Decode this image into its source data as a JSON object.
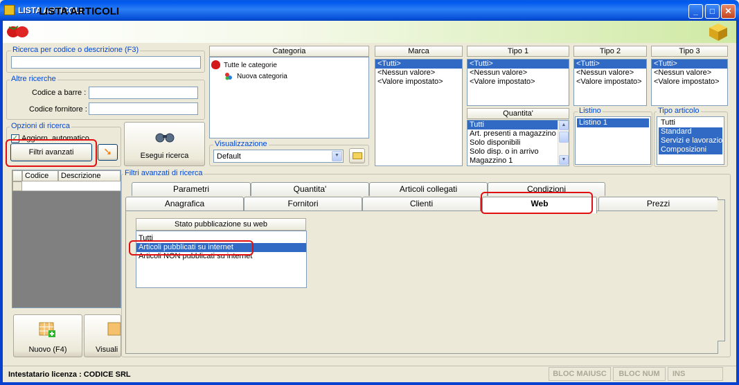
{
  "window": {
    "title": "LISTA ARTICOLI"
  },
  "header": {
    "title": "LISTA ARTICOLI"
  },
  "search": {
    "label": "Ricerca per codice o descrizione (F3)",
    "value": ""
  },
  "altre": {
    "label": "Altre ricerche",
    "barcode_label": "Codice a barre :",
    "supplier_label": "Codice fornitore :"
  },
  "opzioni": {
    "label": "Opzioni di ricerca",
    "auto_update_label": "Aggiorn. automatico",
    "filtri_button": "Filtri avanzati"
  },
  "esegui": {
    "label": "Esegui ricerca"
  },
  "grid": {
    "columns": [
      "Codice",
      "Descrizione"
    ]
  },
  "categoria": {
    "header": "Categoria",
    "root": "Tutte le categorie",
    "child": "Nuova categoria"
  },
  "visualizzazione": {
    "label": "Visualizzazione",
    "value": "Default"
  },
  "marca": {
    "header": "Marca",
    "items": [
      "<Tutti>",
      "<Nessun valore>",
      "<Valore impostato>"
    ]
  },
  "tipo1": {
    "header": "Tipo 1",
    "items": [
      "<Tutti>",
      "<Nessun valore>",
      "<Valore impostato>"
    ]
  },
  "tipo2": {
    "header": "Tipo 2",
    "items": [
      "<Tutti>",
      "<Nessun valore>",
      "<Valore impostato>"
    ]
  },
  "tipo3": {
    "header": "Tipo 3",
    "items": [
      "<Tutti>",
      "<Nessun valore>",
      "<Valore impostato>"
    ]
  },
  "quantita": {
    "header": "Quantita'",
    "items": [
      "Tutti",
      "Art. presenti a magazzino",
      "Solo disponibili",
      "Solo disp. o in arrivo",
      "Magazzino 1"
    ]
  },
  "listino": {
    "label": "Listino",
    "items": [
      "Listino 1"
    ]
  },
  "tipo_articolo": {
    "label": "Tipo articolo",
    "items": [
      "Tutti",
      "Standard",
      "Servizi e lavorazioni",
      "Composizioni"
    ]
  },
  "filtri": {
    "label": "Filtri avanzati di ricerca"
  },
  "tabs_row1": [
    "Parametri",
    "Quantita'",
    "Articoli collegati",
    "Condizioni"
  ],
  "tabs_row2": [
    "Anagrafica",
    "Fornitori",
    "Clienti",
    "Web",
    "Prezzi"
  ],
  "web": {
    "header": "Stato pubblicazione su web",
    "items": [
      "Tutti",
      "Articoli pubblicati su internet",
      "Articoli NON pubblicati su internet"
    ]
  },
  "buttons": {
    "nuovo": "Nuovo (F4)",
    "visualizza": "Visuali"
  },
  "status": {
    "license": "Intestatario licenza : CODICE SRL",
    "caps": "BLOC MAIUSC",
    "num": "BLOC NUM",
    "ins": "INS"
  }
}
